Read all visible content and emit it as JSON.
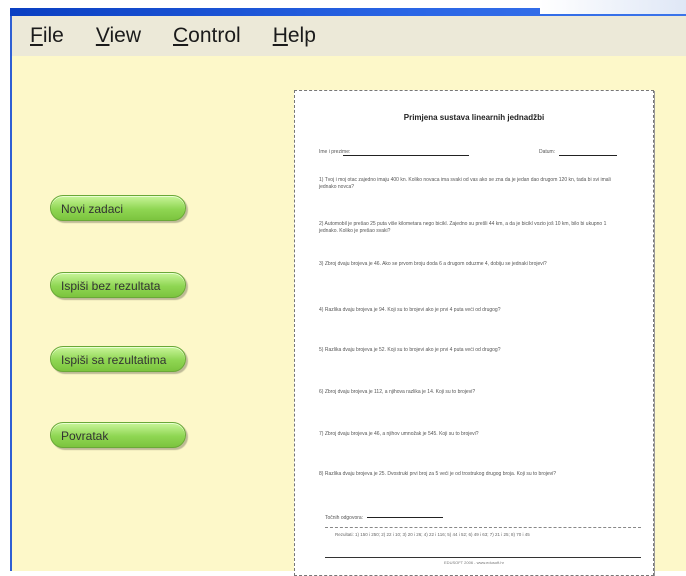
{
  "menubar": {
    "items": [
      {
        "access_key": "F",
        "rest": "ile"
      },
      {
        "access_key": "V",
        "rest": "iew"
      },
      {
        "access_key": "C",
        "rest": "ontrol"
      },
      {
        "access_key": "H",
        "rest": "elp"
      }
    ]
  },
  "buttons": {
    "new_tasks": "Novi zadaci",
    "print_without_results": "Ispiši bez rezultata",
    "print_with_results": "Ispiši sa rezultatima",
    "back": "Povratak"
  },
  "worksheet": {
    "title": "Primjena sustava linearnih jednadžbi",
    "name_label": "Ime i prezime:",
    "date_label": "Datum:",
    "tasks": [
      "1) Tvoj i moj otac zajedno imaju 400 kn. Koliko novaca ima svaki od vas ako se zna da je jedan dao drugom 120 kn, tada bi svi imali jednako novca?",
      "2) Automobil je prešao 25 puta više kilometara nego bicikl. Zajedno su prešli 44 km, a da je bicikl vozio još 10 km, bilo bi ukupno 1 jednako. Koliko je prešao svaki?",
      "3) Zbroj dvaju brojeva je 46. Ako se prvom broju doda 6 a drugom oduzme 4, dobiju se jednaki brojevi?",
      "4) Razlika dvaju brojeva je 94. Koji su to brojevi ako je prvi 4 puta veći od drugog?",
      "5) Razlika dvaju brojeva je 52. Koji su to brojevi ako je prvi 4 puta veći od drugog?",
      "6) Zbroj dvaju brojeva je 112, a njihova razlika je 14. Koji su to brojevi?",
      "7) Zbroj dvaju brojeva je 46, a njihov umnožak je 545. Koji su to brojevi?",
      "8) Razlika dvaju brojeva je 25. Dvostruki prvi broj za 5 veći je od trostrukog drugog broja. Koji su to brojevi?"
    ],
    "signature_label": "Točnih odgovora:",
    "results_line": "Rezultati: 1) 150 i 250; 2) 22 i 10; 3) 20 i 26; 4) 22 i 116; 5) 44 i 52; 6) 49 i 63; 7) 21 i 25; 8) 70 i 45",
    "footer": "EDUSOFT 2006 - www.edusoft.hr"
  }
}
